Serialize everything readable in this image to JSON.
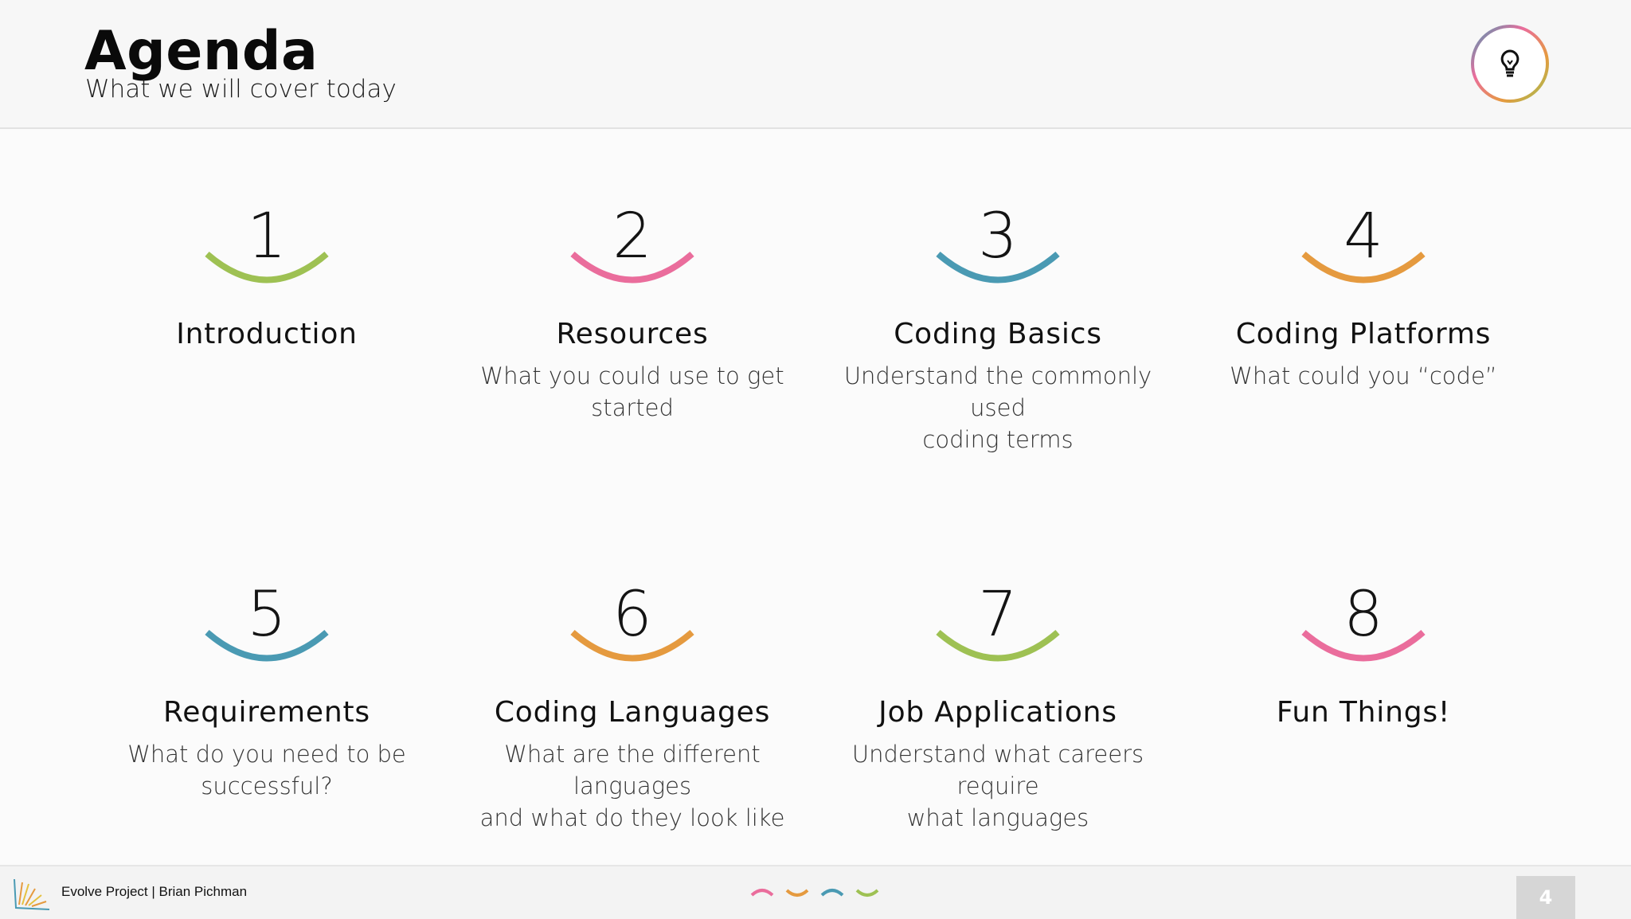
{
  "header": {
    "title": "Agenda",
    "subtitle": "What we will cover today",
    "icon": "lightbulb-icon"
  },
  "items": [
    {
      "number": "1",
      "title": "Introduction",
      "desc_line1": "",
      "desc_line2": "",
      "color": "#9ec153"
    },
    {
      "number": "2",
      "title": "Resources",
      "desc_line1": "What you could use to get started",
      "desc_line2": "",
      "color": "#ea6d9c"
    },
    {
      "number": "3",
      "title": "Coding Basics",
      "desc_line1": "Understand the commonly used",
      "desc_line2": "coding terms",
      "color": "#4a9ab3"
    },
    {
      "number": "4",
      "title": "Coding Platforms",
      "desc_line1": "What could you “code”",
      "desc_line2": "",
      "color": "#e59a3f"
    },
    {
      "number": "5",
      "title": "Requirements",
      "desc_line1": "What do you need to be",
      "desc_line2": "successful?",
      "color": "#4a9ab3"
    },
    {
      "number": "6",
      "title": "Coding Languages",
      "desc_line1": "What are the different languages",
      "desc_line2": "and what do they look like",
      "color": "#e59a3f"
    },
    {
      "number": "7",
      "title": "Job Applications",
      "desc_line1": "Understand what careers require",
      "desc_line2": "what languages",
      "color": "#9ec153"
    },
    {
      "number": "8",
      "title": "Fun Things!",
      "desc_line1": "",
      "desc_line2": "",
      "color": "#ea6d9c"
    }
  ],
  "footer": {
    "text": "Evolve Project | Brian Pichman",
    "page_number": "4"
  },
  "colors": {
    "green": "#9ec153",
    "pink": "#ea6d9c",
    "blue": "#4a9ab3",
    "orange": "#e59a3f"
  }
}
